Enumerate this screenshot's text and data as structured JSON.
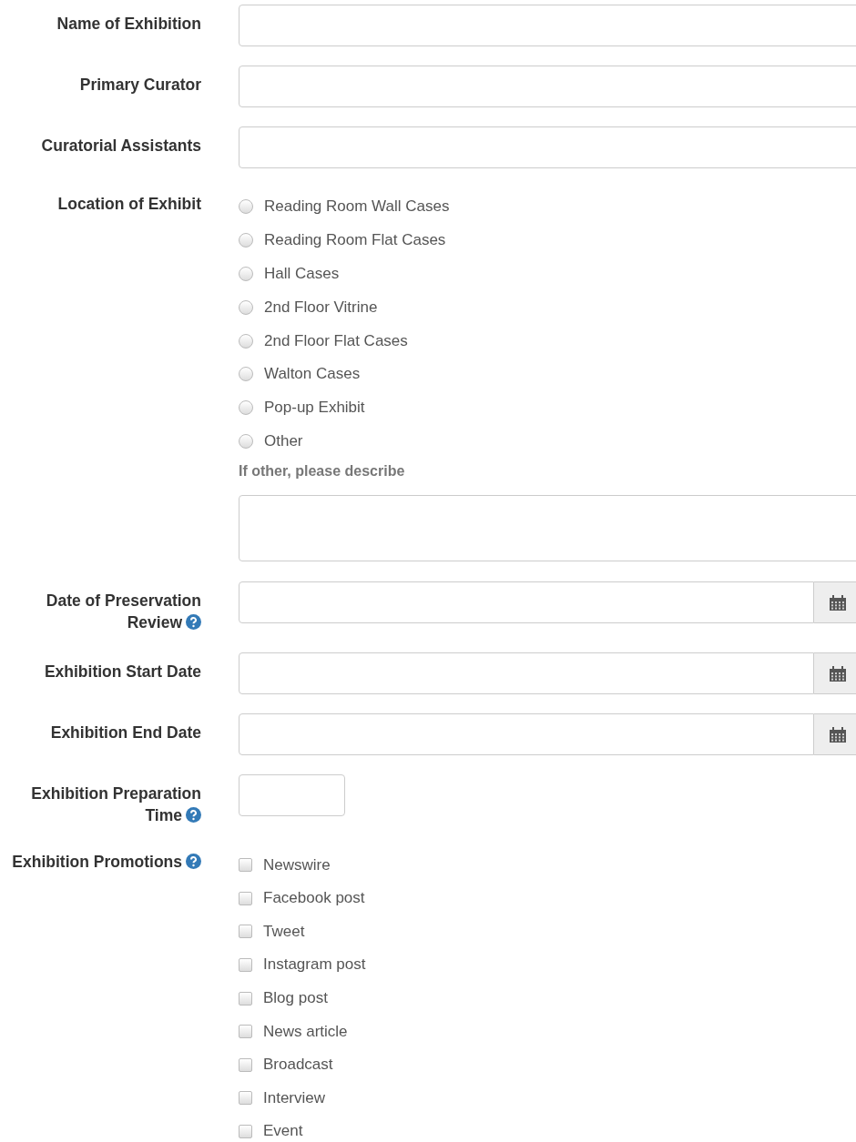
{
  "rows": [
    {
      "label": "Name of Exhibition",
      "kind": "text",
      "help": false
    },
    {
      "label": "Primary Curator",
      "kind": "text",
      "help": false
    },
    {
      "label": "Curatorial Assistants",
      "kind": "text",
      "help": false
    },
    {
      "label": "Location of Exhibit",
      "kind": "radio",
      "help": false,
      "options": [
        {
          "label": "Reading Room Wall Cases",
          "selected": false
        },
        {
          "label": "Reading Room Flat Cases",
          "selected": false
        },
        {
          "label": "Hall Cases",
          "selected": false
        },
        {
          "label": "2nd Floor Vitrine",
          "selected": false
        },
        {
          "label": "2nd Floor Flat Cases",
          "selected": false
        },
        {
          "label": "Walton Cases",
          "selected": false
        },
        {
          "label": "Pop-up Exhibit",
          "selected": false
        },
        {
          "label": "Other",
          "selected": false
        }
      ],
      "other_prompt": "If other, please describe"
    },
    {
      "label": "Date of Preservation Review",
      "kind": "date",
      "help": true
    },
    {
      "label": "Exhibition Start Date",
      "kind": "date",
      "help": false
    },
    {
      "label": "Exhibition End Date",
      "kind": "date",
      "help": false
    },
    {
      "label": "Exhibition Preparation Time",
      "kind": "short",
      "help": true
    },
    {
      "label": "Exhibition Promotions",
      "kind": "checkbox",
      "help": true,
      "options": [
        {
          "label": "Newswire",
          "checked": false
        },
        {
          "label": "Facebook post",
          "checked": false
        },
        {
          "label": "Tweet",
          "checked": false
        },
        {
          "label": "Instagram post",
          "checked": false
        },
        {
          "label": "Blog post",
          "checked": false
        },
        {
          "label": "News article",
          "checked": false
        },
        {
          "label": "Broadcast",
          "checked": false
        },
        {
          "label": "Interview",
          "checked": false
        },
        {
          "label": "Event",
          "checked": false
        }
      ]
    }
  ]
}
